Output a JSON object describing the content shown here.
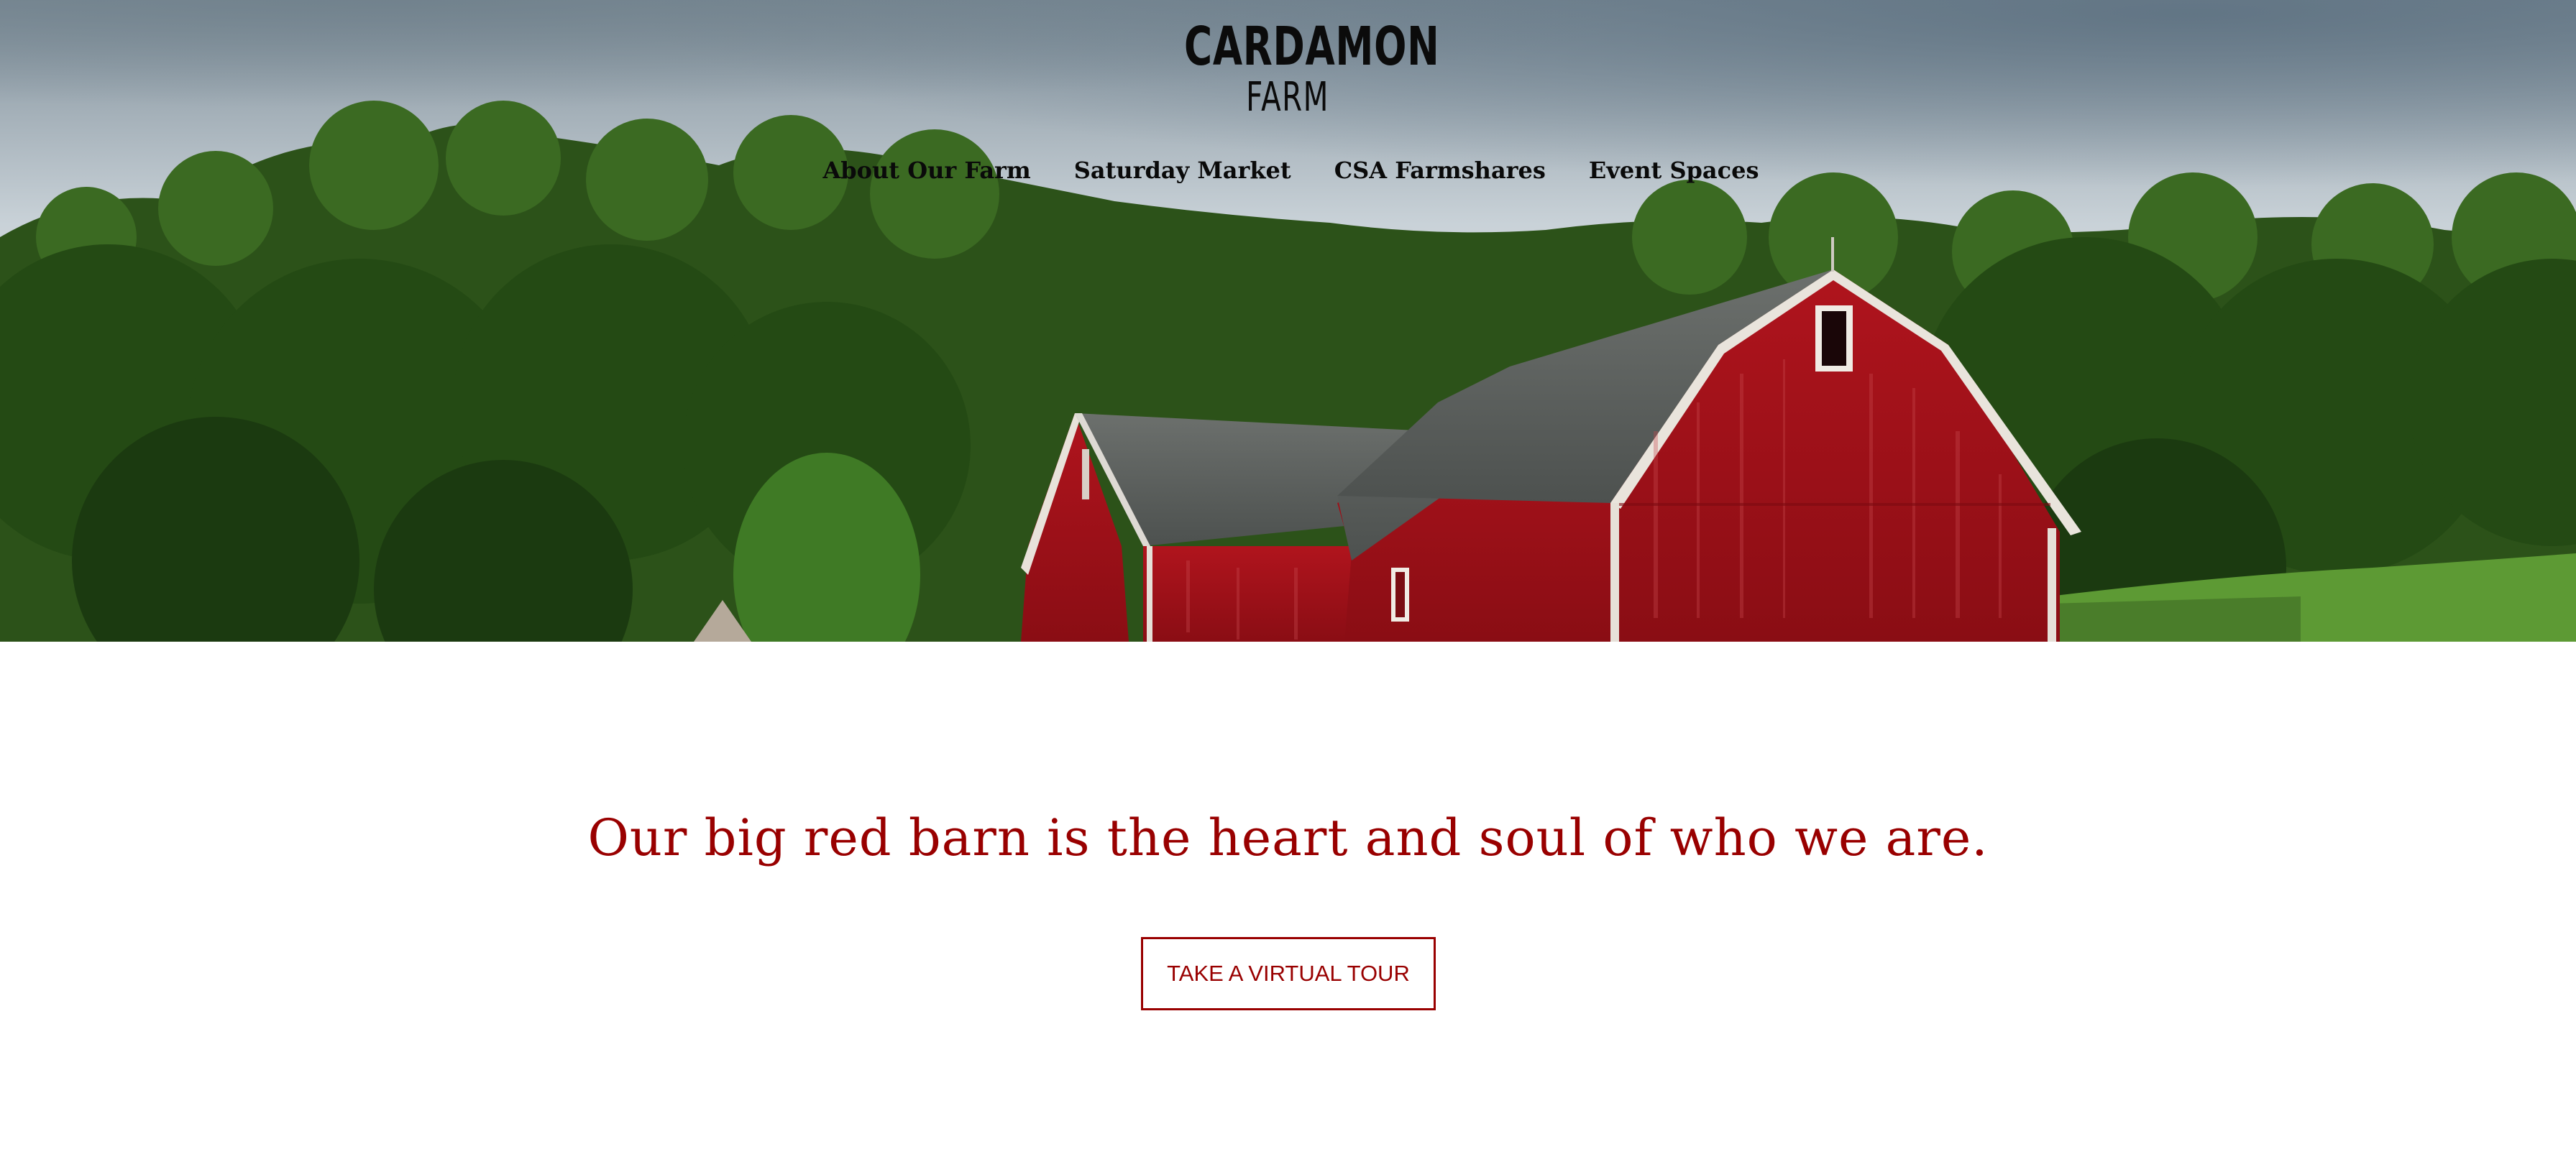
{
  "header": {
    "logo_line1": "CARDAMON",
    "logo_line2": "FARM"
  },
  "nav": {
    "items": [
      {
        "label": "About Our Farm"
      },
      {
        "label": "Saturday Market"
      },
      {
        "label": "CSA Farmshares"
      },
      {
        "label": "Event Spaces"
      }
    ]
  },
  "intro": {
    "tagline": "Our big red barn is the heart and soul of who we are.",
    "cta_label": "TAKE A VIRTUAL TOUR"
  },
  "colors": {
    "accent": "#990000",
    "nav_text": "#0a0a0a",
    "barn_red": "#a5121c",
    "roof_gray": "#5f6361"
  }
}
